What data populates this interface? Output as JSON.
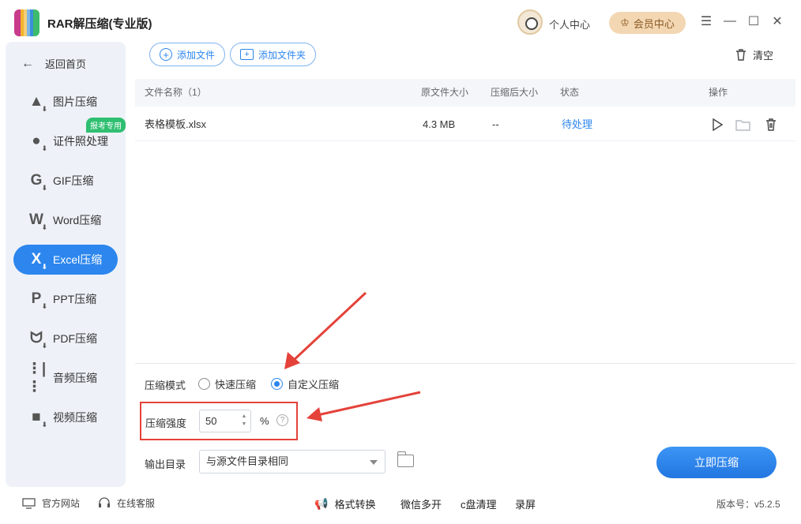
{
  "app": {
    "title": "RAR解压缩(专业版)"
  },
  "header": {
    "user_center": "个人中心",
    "vip_center": "会员中心",
    "controls": [
      "menu-icon",
      "minimize-icon",
      "maximize-icon",
      "close-icon"
    ]
  },
  "sidebar": {
    "back_label": "返回首页",
    "badge": "报考专用",
    "items": [
      {
        "label": "图片压缩",
        "icon": "image-compress-icon"
      },
      {
        "label": "证件照处理",
        "icon": "id-photo-icon"
      },
      {
        "label": "GIF压缩",
        "icon": "gif-compress-icon"
      },
      {
        "label": "Word压缩",
        "icon": "word-compress-icon"
      },
      {
        "label": "Excel压缩",
        "icon": "excel-compress-icon",
        "active": true
      },
      {
        "label": "PPT压缩",
        "icon": "ppt-compress-icon"
      },
      {
        "label": "PDF压缩",
        "icon": "pdf-compress-icon"
      },
      {
        "label": "音频压缩",
        "icon": "audio-compress-icon"
      },
      {
        "label": "视频压缩",
        "icon": "video-compress-icon"
      }
    ]
  },
  "toolbar": {
    "add_file": "添加文件",
    "add_folder": "添加文件夹",
    "clear": "清空"
  },
  "table": {
    "headers": {
      "name": "文件名称（1）",
      "orig_size": "原文件大小",
      "comp_size": "压缩后大小",
      "status": "状态",
      "actions": "操作"
    },
    "rows": [
      {
        "name": "表格模板.xlsx",
        "orig_size": "4.3 MB",
        "comp_size": "--",
        "status": "待处理"
      }
    ]
  },
  "settings": {
    "mode_label": "压缩模式",
    "mode_fast": "快速压缩",
    "mode_custom": "自定义压缩",
    "mode_selected": "custom",
    "strength_label": "压缩强度",
    "strength_value": "50",
    "strength_unit": "%",
    "help_glyph": "?",
    "output_label": "输出目录",
    "output_value": "与源文件目录相同",
    "start_button": "立即压缩"
  },
  "footer": {
    "website": "官方网站",
    "support": "在线客服",
    "tools": [
      "格式转换",
      "微信多开",
      "c盘清理",
      "录屏"
    ],
    "version": "版本号：v5.2.5"
  },
  "colors": {
    "accent": "#2c86ee",
    "annotation": "#e4423a",
    "vip": "#f3d7b3"
  }
}
